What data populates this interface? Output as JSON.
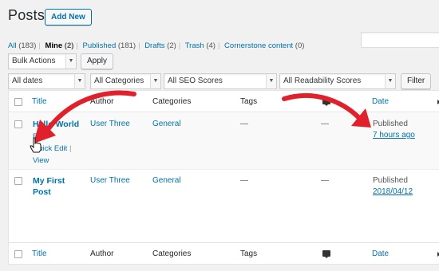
{
  "header": {
    "title": "Posts",
    "add_new": "Add New"
  },
  "filters_links": [
    {
      "label": "All",
      "count": "(183)",
      "current": false
    },
    {
      "label": "Mine",
      "count": "(2)",
      "current": true
    },
    {
      "label": "Published",
      "count": "(181)",
      "current": false
    },
    {
      "label": "Drafts",
      "count": "(2)",
      "current": false
    },
    {
      "label": "Trash",
      "count": "(4)",
      "current": false
    },
    {
      "label": "Cornerstone content",
      "count": "(0)",
      "current": false
    }
  ],
  "bulk": {
    "select": "Bulk Actions",
    "apply": "Apply"
  },
  "filters": {
    "dates": "All dates",
    "categories": "All Categories",
    "seo": "All SEO Scores",
    "readability": "All Readability Scores",
    "filter_button": "Filter"
  },
  "columns": {
    "title": "Title",
    "author": "Author",
    "categories": "Categories",
    "tags": "Tags",
    "date": "Date"
  },
  "rows": [
    {
      "title": "Hello World",
      "actions": {
        "edit": "Edit",
        "quick_edit": "Quick Edit",
        "view": "View",
        "sep": "|"
      },
      "author": "User Three",
      "categories": "General",
      "tags": "—",
      "comments": "—",
      "date_status": "Published",
      "date": "7 hours ago"
    },
    {
      "title_line1": "My First",
      "title_line2": "Post",
      "author": "User Three",
      "categories": "General",
      "tags": "—",
      "comments": "—",
      "date_status": "Published",
      "date": "2018/04/12"
    }
  ],
  "icons": {
    "comments": "comment-bubble-icon",
    "sort": "sort-arrow-icon",
    "cursor": "hand-pointer-icon",
    "annotation": "red-arrow-annotation"
  },
  "colors": {
    "link": "#0073aa",
    "annotation": "#e0202a",
    "background": "#f1f1f1"
  }
}
